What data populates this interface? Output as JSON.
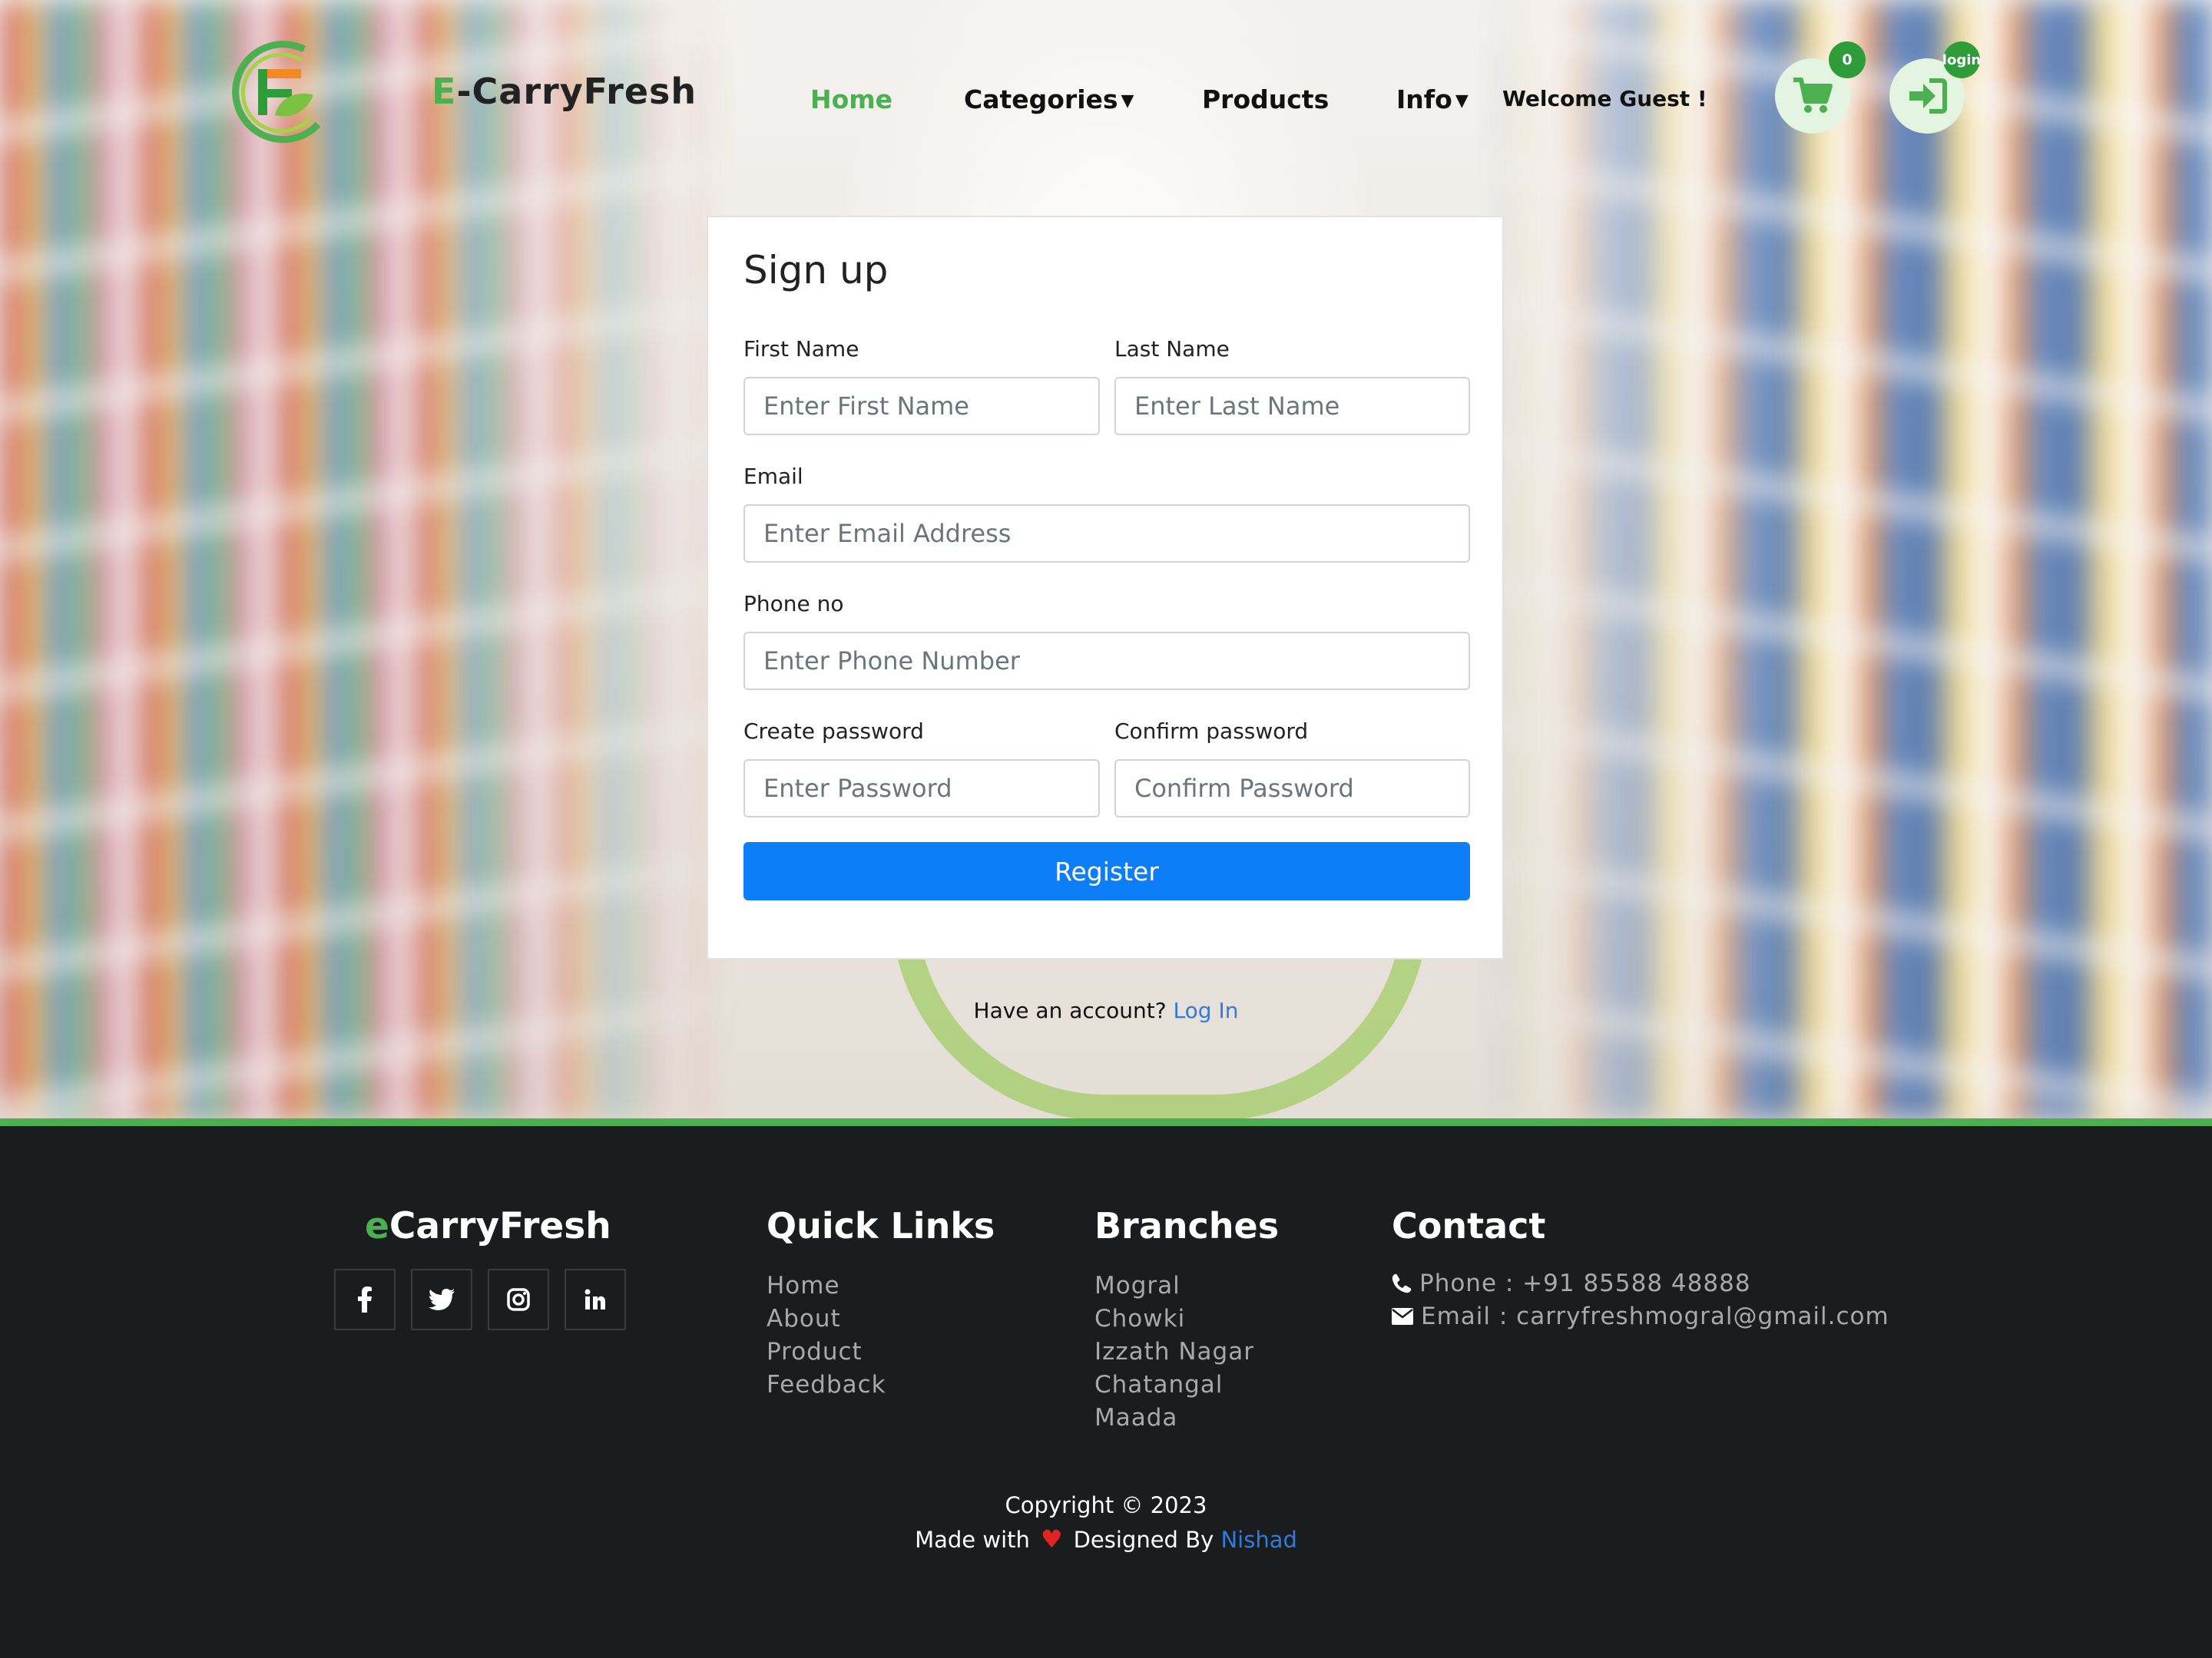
{
  "nav": {
    "brand_prefix": "E",
    "brand_rest": "-CarryFresh",
    "items": [
      {
        "label": "Home"
      },
      {
        "label": "Categories"
      },
      {
        "label": "Products"
      },
      {
        "label": "Info"
      }
    ],
    "welcome": "Welcome Guest !",
    "cart_count": "0",
    "login_badge": "login"
  },
  "form": {
    "title": "Sign up",
    "first_name_label": "First Name",
    "first_name_placeholder": "Enter First Name",
    "last_name_label": "Last Name",
    "last_name_placeholder": "Enter Last Name",
    "email_label": "Email",
    "email_placeholder": "Enter Email Address",
    "phone_label": "Phone no",
    "phone_placeholder": "Enter Phone Number",
    "password_label": "Create password",
    "password_placeholder": "Enter Password",
    "confirm_label": "Confirm password",
    "confirm_placeholder": "Confirm Password",
    "register_label": "Register",
    "have_account": "Have an account?",
    "login_link": "Log In"
  },
  "footer": {
    "brand_prefix": "e",
    "brand_rest": "CarryFresh",
    "social": [
      "f",
      "twitter",
      "instagram",
      "in"
    ],
    "quick_links_title": "Quick Links",
    "quick_links": [
      "Home",
      "About",
      "Product",
      "Feedback"
    ],
    "branches_title": "Branches",
    "branches": [
      "Mogral",
      "Chowki",
      "Izzath Nagar",
      "Chatangal",
      "Maada"
    ],
    "contact_title": "Contact",
    "phone": "Phone : +91 85588 48888",
    "email": "Email : carryfreshmogral@gmail.com",
    "copyright": "Copyright © 2023",
    "made_with": "Made with",
    "designed_by": "Designed By",
    "designer": "Nishad"
  },
  "colors": {
    "accent": "#4caf50",
    "primary_button": "#0d7ef7",
    "footer_bg": "#1b1c1e",
    "link": "#2f7be0"
  }
}
